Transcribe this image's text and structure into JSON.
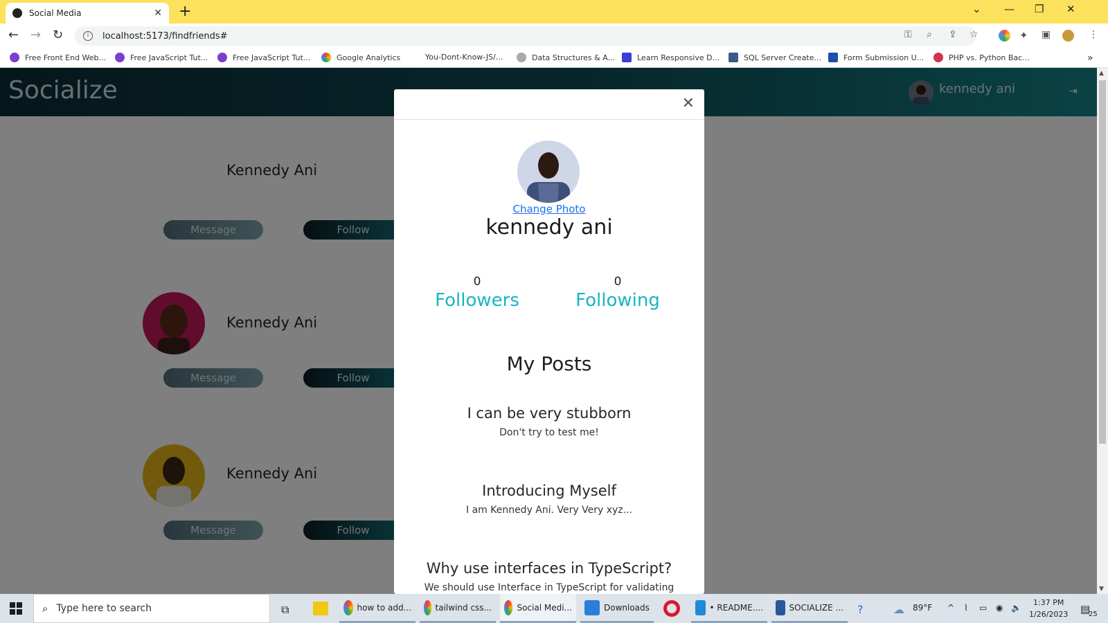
{
  "browser": {
    "tab_title": "Social Media",
    "url": "localhost:5173/findfriends#",
    "bookmarks": [
      "Free Front End Web...",
      "Free JavaScript Tut...",
      "Free JavaScript Tut...",
      "Google Analytics",
      "You-Dont-Know-JS/...",
      "Data Structures & A...",
      "Learn Responsive D...",
      "SQL Server Create...",
      "Form Submission U...",
      "PHP vs. Python Bac..."
    ]
  },
  "app": {
    "brand": "Socialize",
    "current_user": "kennedy ani",
    "friends": [
      {
        "name": "Kennedy Ani",
        "message_label": "Message",
        "follow_label": "Follow"
      },
      {
        "name": "Kennedy Ani",
        "message_label": "Message",
        "follow_label": "Follow"
      },
      {
        "name": "Kennedy Ani",
        "message_label": "Message",
        "follow_label": "Follow"
      }
    ]
  },
  "modal": {
    "change_photo": "Change Photo",
    "name": "kennedy ani",
    "followers_count": "0",
    "followers_label": "Followers",
    "following_count": "0",
    "following_label": "Following",
    "posts_title": "My Posts",
    "posts": [
      {
        "title": "I can be very stubborn",
        "body": "Don't try to test me!"
      },
      {
        "title": "Introducing Myself",
        "body": "I am Kennedy Ani. Very Very xyz..."
      },
      {
        "title": "Why use interfaces in TypeScript?",
        "body": "We should use Interface in TypeScript for validating"
      }
    ]
  },
  "taskbar": {
    "search_placeholder": "Type here to search",
    "apps": [
      "how to add...",
      "tailwind css...",
      "Social Medi...",
      "Downloads",
      "• README....",
      "SOCIALIZE ..."
    ],
    "weather": "89°F",
    "time": "1:37 PM",
    "date": "1/26/2023",
    "notifications": "25"
  },
  "colors": {
    "tabbar": "#fce15c",
    "accent": "#18b5c2",
    "link": "#1a6ef0"
  }
}
